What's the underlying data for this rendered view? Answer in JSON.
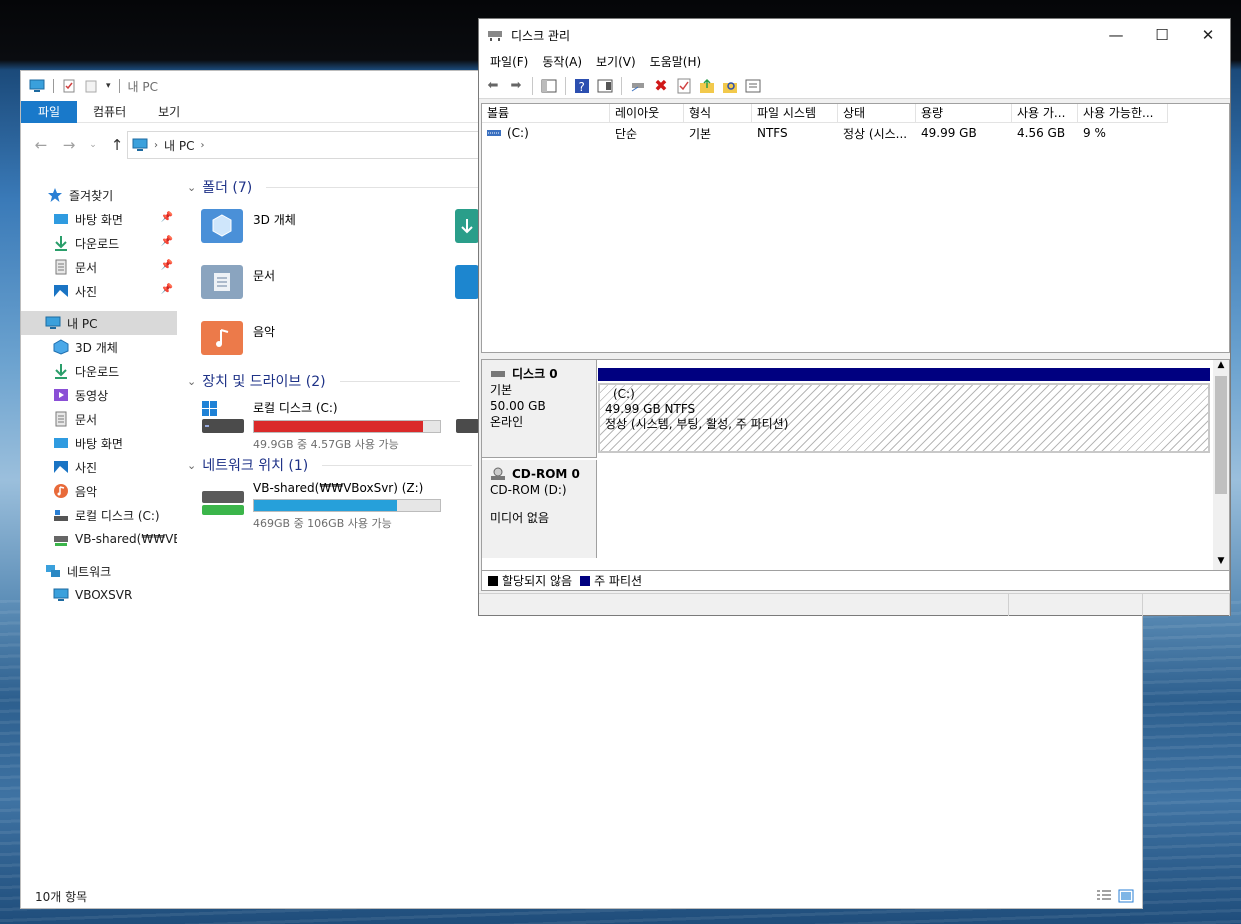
{
  "explorer": {
    "title": "내 PC",
    "tabs": [
      "파일",
      "컴퓨터",
      "보기"
    ],
    "address": {
      "location": "내 PC"
    },
    "sidebar": {
      "quick_access": "즐겨찾기",
      "quick_items": [
        "바탕 화면",
        "다운로드",
        "문서",
        "사진"
      ],
      "this_pc": "내 PC",
      "pc_items": [
        "3D 개체",
        "다운로드",
        "동영상",
        "문서",
        "바탕 화면",
        "사진",
        "음악",
        "로컬 디스크 (C:)",
        "VB-shared(₩₩VBoxSvr)"
      ],
      "network": "네트워크",
      "network_items": [
        "VBOXSVR"
      ]
    },
    "groups": {
      "folders": "폴더 (7)",
      "devices": "장치 및 드라이브 (2)",
      "network": "네트워크 위치 (1)"
    },
    "folders": [
      "3D 개체",
      "문서",
      "음악"
    ],
    "drives": [
      {
        "name": "로컬 디스크 (C:)",
        "detail": "49.9GB 중 4.57GB 사용 가능",
        "used_fraction": 0.91,
        "color": "#da2a2a"
      },
      {
        "name": "VB-shared(₩₩VBoxSvr) (Z:)",
        "detail": "469GB 중 106GB 사용 가능",
        "used_fraction": 0.77,
        "color": "#26a0da"
      }
    ],
    "status": "10개 항목"
  },
  "diskmgmt": {
    "title": "디스크 관리",
    "menu": [
      "파일(F)",
      "동작(A)",
      "보기(V)",
      "도움말(H)"
    ],
    "columns": [
      "볼륨",
      "레이아웃",
      "형식",
      "파일 시스템",
      "상태",
      "용량",
      "사용 가...",
      "사용 가능한..."
    ],
    "row": [
      "(C:)",
      "단순",
      "기본",
      "NTFS",
      "정상 (시스...",
      "49.99 GB",
      "4.56 GB",
      "9 %"
    ],
    "disk0": {
      "name": "디스크 0",
      "type": "기본",
      "size": "50.00 GB",
      "state": "온라인"
    },
    "partition": {
      "label": "(C:)",
      "size": "49.99 GB NTFS",
      "status": "정상 (시스템, 부팅, 활성, 주 파티션)"
    },
    "cdrom": {
      "name": "CD-ROM 0",
      "drive": "CD-ROM (D:)",
      "media": "미디어 없음"
    },
    "legend": [
      "할당되지 않음",
      "주 파티션"
    ],
    "colors": {
      "primary": "#000080",
      "unallocated": "#000000"
    }
  }
}
